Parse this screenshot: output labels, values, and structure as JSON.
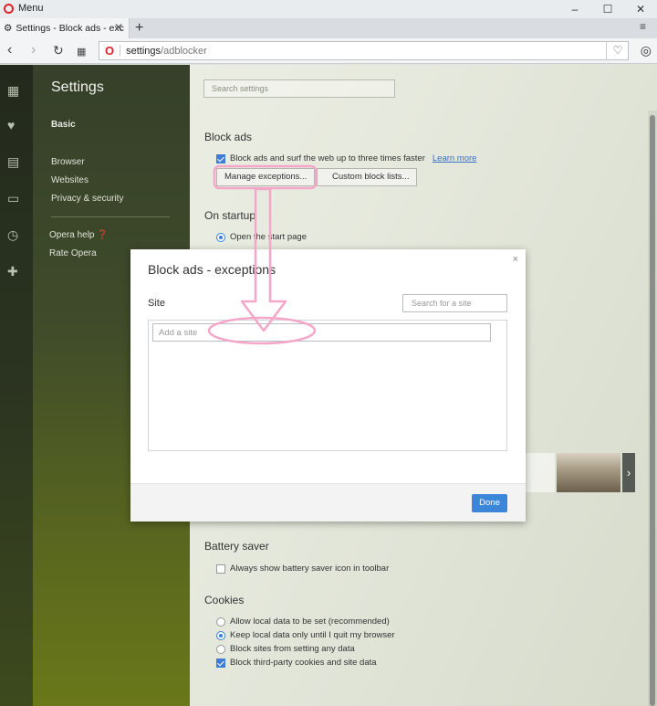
{
  "window": {
    "menu_label": "Menu",
    "tab_title": "Settings - Block ads - exc",
    "minimize": "–",
    "maximize": "☐",
    "close": "✕"
  },
  "address": {
    "url_host": "settings",
    "url_path": "/adblocker"
  },
  "sidebar": {
    "title": "Settings",
    "basic": "Basic",
    "items": [
      "Browser",
      "Websites",
      "Privacy & security"
    ],
    "help": "Opera help",
    "rate": "Rate Opera"
  },
  "main": {
    "search_placeholder": "Search settings",
    "block_ads": {
      "heading": "Block ads",
      "checkbox_label": "Block ads and surf the web up to three times faster",
      "learn_more": "Learn more",
      "manage_button": "Manage exceptions...",
      "custom_button": "Custom block lists..."
    },
    "on_startup": {
      "heading": "On startup",
      "option1": "Open the start page"
    },
    "battery": {
      "heading": "Battery saver",
      "option": "Always show battery saver icon in toolbar"
    },
    "cookies": {
      "heading": "Cookies",
      "options": [
        "Allow local data to be set (recommended)",
        "Keep local data only until I quit my browser",
        "Block sites from setting any data",
        "Block third-party cookies and site data"
      ]
    }
  },
  "modal": {
    "title": "Block ads - exceptions",
    "close": "×",
    "site_label": "Site",
    "search_placeholder": "Search for a site",
    "add_placeholder": "Add a site",
    "done": "Done"
  },
  "colors": {
    "accent": "#3b86d9",
    "annotation": "#f4a7c8",
    "opera_red": "#e0202a"
  }
}
